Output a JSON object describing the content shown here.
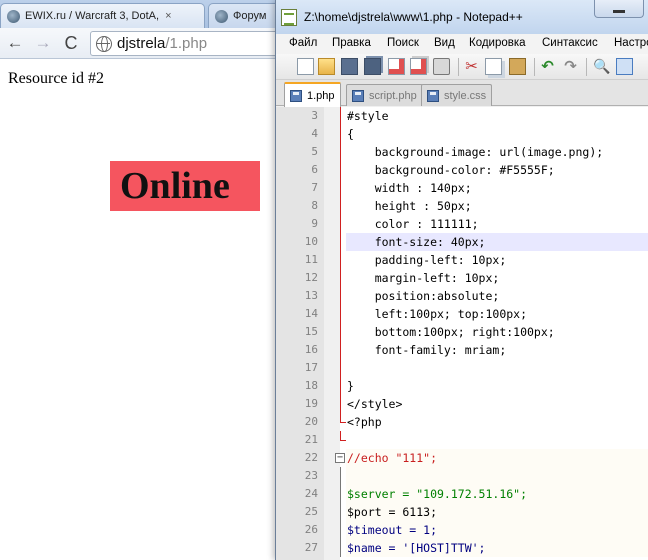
{
  "browser": {
    "tabs": [
      {
        "title": "EWIX.ru / Warcraft 3, DotA,",
        "close": "×"
      },
      {
        "title": "Форум",
        "close": ""
      }
    ],
    "nav": {
      "back": "←",
      "forward": "→",
      "reload": "C"
    },
    "url": {
      "host": "djstrela",
      "path": "/1.php"
    },
    "page": {
      "resource_text": "Resource id #2",
      "online_text": "Online",
      "online_bg": "#F5555F"
    }
  },
  "notepad": {
    "title": "Z:\\home\\djstrela\\www\\1.php - Notepad++",
    "menu": [
      "Файл",
      "Правка",
      "Поиск",
      "Вид",
      "Кодировка",
      "Синтаксис",
      "Настро"
    ],
    "toolbar_icons": [
      "new-file-icon",
      "open-file-icon",
      "save-icon",
      "save-all-icon",
      "close-file-icon",
      "close-all-icon",
      "print-icon",
      "cut-icon",
      "copy-icon",
      "paste-icon",
      "undo-icon",
      "redo-icon",
      "find-icon",
      "replace-icon"
    ],
    "tabs": [
      {
        "label": "1.php",
        "active": true
      },
      {
        "label": "script.php",
        "active": false
      },
      {
        "label": "style.css",
        "active": false
      }
    ],
    "lines": [
      {
        "n": "3",
        "text": "#style"
      },
      {
        "n": "4",
        "text": "{"
      },
      {
        "n": "5",
        "text": "    background-image: url(image.png);"
      },
      {
        "n": "6",
        "text": "    background-color: #F5555F;"
      },
      {
        "n": "7",
        "text": "    width : 140px;"
      },
      {
        "n": "8",
        "text": "    height : 50px;"
      },
      {
        "n": "9",
        "text": "    color : 111111;"
      },
      {
        "n": "10",
        "text": "    font-size: 40px;"
      },
      {
        "n": "11",
        "text": "    padding-left: 10px;"
      },
      {
        "n": "12",
        "text": "    margin-left: 10px;"
      },
      {
        "n": "13",
        "text": "    position:absolute;"
      },
      {
        "n": "14",
        "text": "    left:100px; top:100px;"
      },
      {
        "n": "15",
        "text": "    bottom:100px; right:100px;"
      },
      {
        "n": "16",
        "text": "    font-family: mriam;"
      },
      {
        "n": "17",
        "text": ""
      },
      {
        "n": "18",
        "text": "}"
      },
      {
        "n": "19",
        "text": "</style>"
      },
      {
        "n": "20",
        "text": "<?php"
      },
      {
        "n": "21",
        "text": ""
      },
      {
        "n": "22",
        "text": "//echo \"111\";"
      },
      {
        "n": "23",
        "text": ""
      },
      {
        "n": "24",
        "text": "$server = \"109.172.51.16\";"
      },
      {
        "n": "25",
        "text": "$port = 6113;"
      },
      {
        "n": "26",
        "text": "$timeout = 1;"
      },
      {
        "n": "27",
        "text": "$name = '[HOST]TTW';"
      }
    ]
  }
}
